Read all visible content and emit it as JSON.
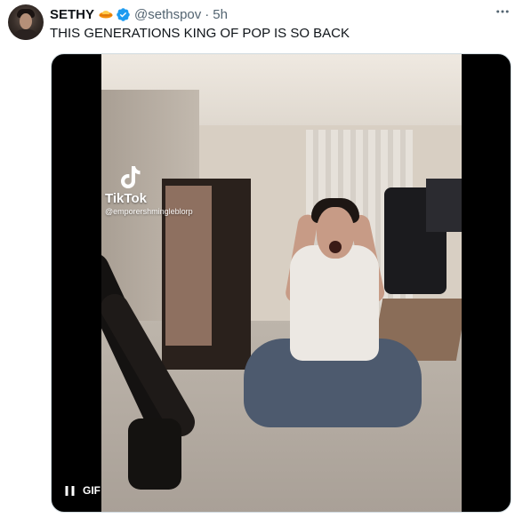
{
  "tweet": {
    "author_name": "SETHY",
    "author_handle": "@sethspov",
    "separator": "·",
    "time": "5h",
    "text": "THIS GENERATIONS KING OF POP IS SO BACK",
    "more_icon": "more-horizontal-icon"
  },
  "media": {
    "watermark": {
      "brand": "TikTok",
      "user": "@emporershmingleblorp"
    },
    "controls": {
      "gif_label": "GIF",
      "pause_icon": "pause-icon"
    }
  },
  "colors": {
    "primary_text": "#0f1419",
    "secondary_text": "#536471",
    "verified_blue": "#1d9bf0"
  }
}
